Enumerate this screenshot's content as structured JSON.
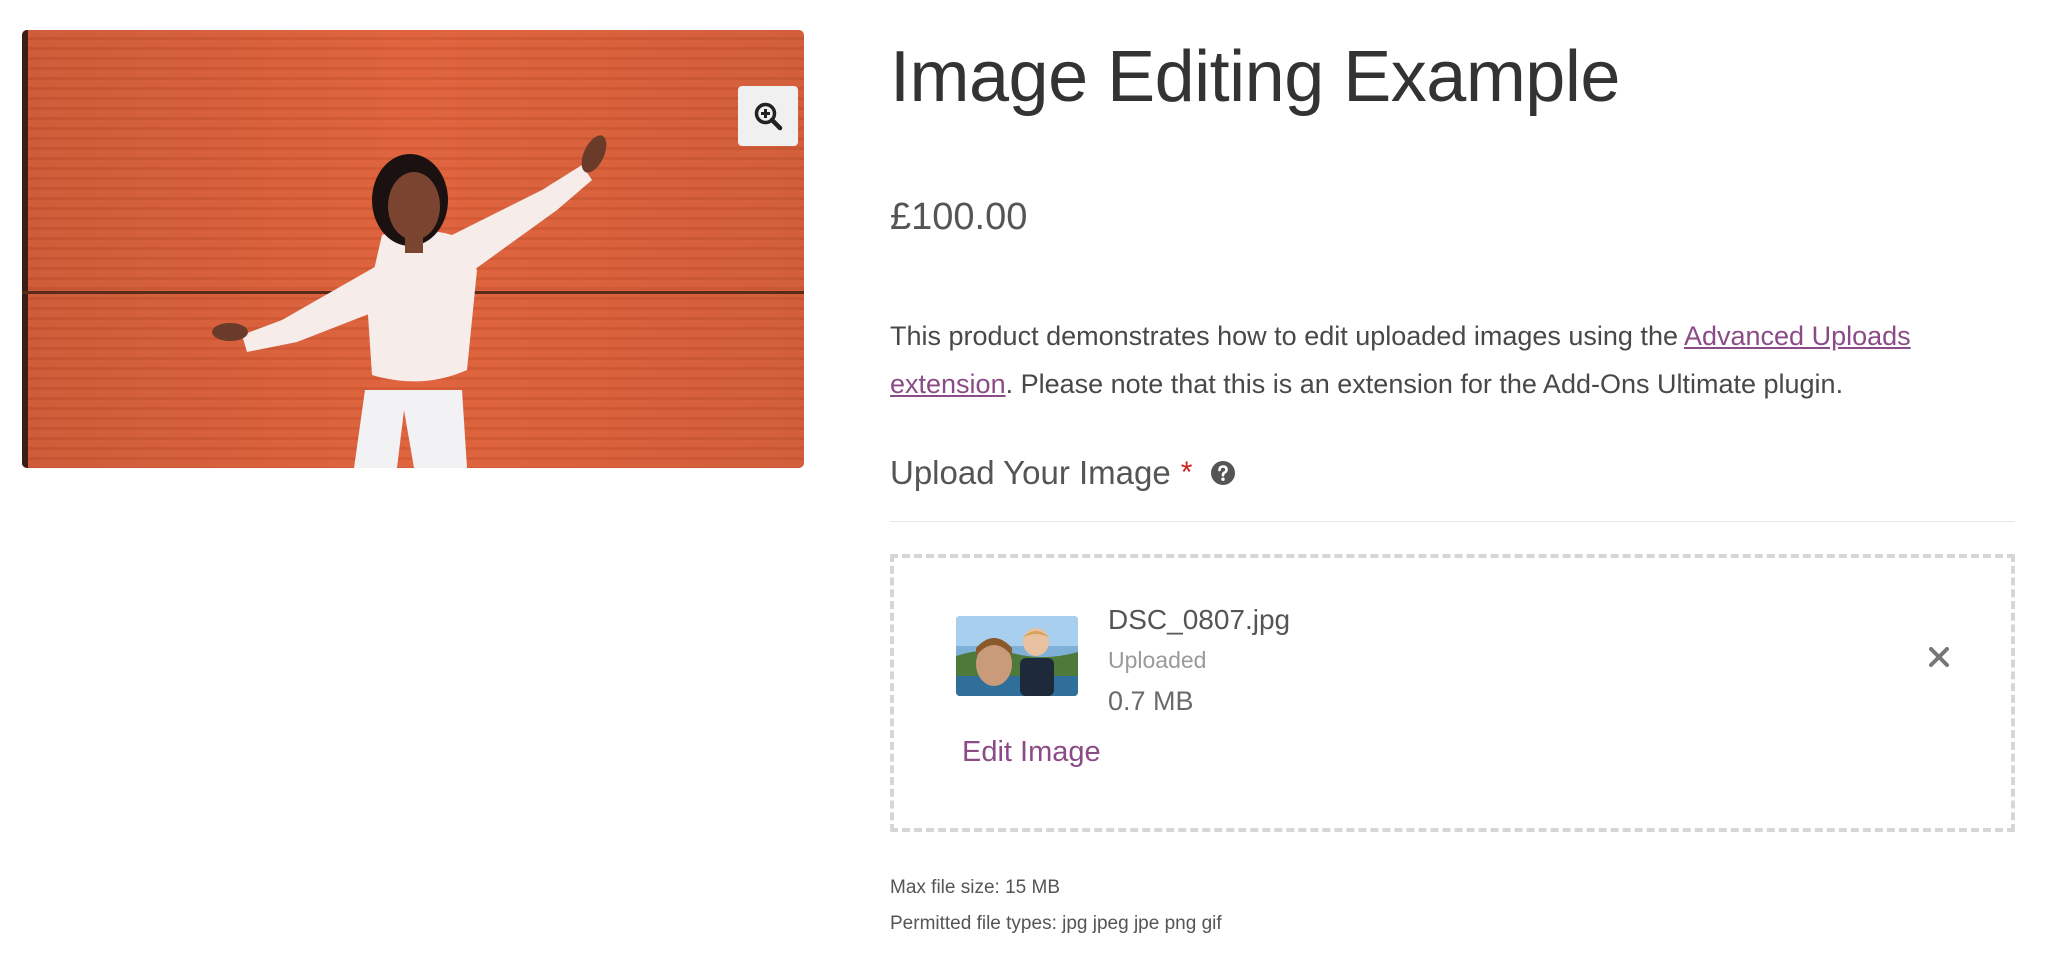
{
  "product": {
    "title": "Image Editing Example",
    "price": "£100.00",
    "description_pre": "This product demonstrates how to edit uploaded images using the ",
    "description_link": "Advanced Uploads extension",
    "description_post": ". Please note that this is an extension for the Add-Ons Ultimate plugin."
  },
  "gallery": {
    "zoom_icon": "zoom-in-icon",
    "wall_color": "#e0653f"
  },
  "upload_field": {
    "label": "Upload Your Image",
    "required_marker": "*",
    "help_icon": "question-circle-icon",
    "file": {
      "name": "DSC_0807.jpg",
      "status": "Uploaded",
      "size": "0.7 MB",
      "edit_label": "Edit Image",
      "remove_icon": "close-icon"
    },
    "max_file_size": "Max file size: 15 MB",
    "permitted_types": "Permitted file types: jpg jpeg jpe png gif"
  },
  "colors": {
    "accent_link": "#8a4b86",
    "required": "#cc2222",
    "dropzone_border": "#d6d6d6"
  }
}
